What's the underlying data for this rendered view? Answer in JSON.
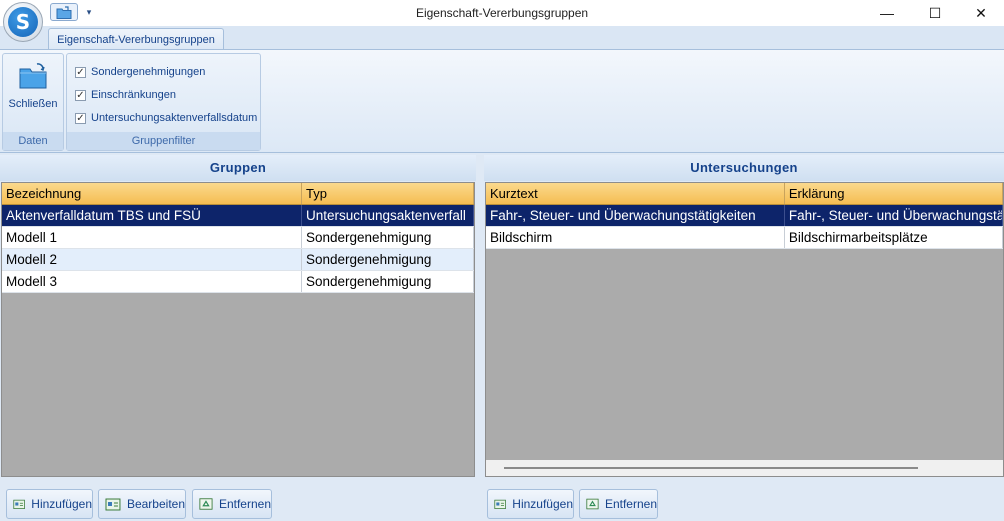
{
  "window": {
    "title": "Eigenschaft-Vererbungsgruppen",
    "app_icon_letter": "S",
    "minimize_glyph": "—",
    "maximize_glyph": "☐",
    "close_glyph": "✕",
    "qat_dropdown_glyph": "▾"
  },
  "ribbon": {
    "active_tab": "Eigenschaft-Vererbungsgruppen",
    "groups": {
      "daten": {
        "label": "Daten",
        "close_button": "Schließen"
      },
      "filter": {
        "label": "Gruppenfilter",
        "checkboxes": [
          {
            "label": "Sondergenehmigungen",
            "checked": true
          },
          {
            "label": "Einschränkungen",
            "checked": true
          },
          {
            "label": "Untersuchungsaktenverfallsdatum",
            "checked": true
          }
        ],
        "check_glyph": "✓"
      }
    }
  },
  "gruppen": {
    "title": "Gruppen",
    "columns": [
      "Bezeichnung",
      "Typ"
    ],
    "rows": [
      {
        "bezeichnung": "Aktenverfalldatum TBS und FSÜ",
        "typ": "Untersuchungsaktenverfall",
        "selected": true
      },
      {
        "bezeichnung": "Modell 1",
        "typ": "Sondergenehmigung"
      },
      {
        "bezeichnung": "Modell 2",
        "typ": "Sondergenehmigung"
      },
      {
        "bezeichnung": "Modell 3",
        "typ": "Sondergenehmigung"
      }
    ],
    "buttons": {
      "add": "Hinzufügen",
      "edit": "Bearbeiten",
      "remove": "Entfernen"
    }
  },
  "untersuchungen": {
    "title": "Untersuchungen",
    "columns": [
      "Kurztext",
      "Erklärung"
    ],
    "rows": [
      {
        "kurztext": "Fahr-, Steuer- und Überwachungstätigkeiten",
        "erklaerung": "Fahr-, Steuer- und Überwachungstätigkeiten",
        "selected": true
      },
      {
        "kurztext": "Bildschirm",
        "erklaerung": "Bildschirmarbeitsplätze"
      }
    ],
    "buttons": {
      "add": "Hinzufügen",
      "remove": "Entfernen"
    }
  },
  "colors": {
    "selection": "#0d246a",
    "header_orange": "#f5bd52",
    "ribbon_text": "#15428b",
    "grid_background": "#ababab"
  }
}
